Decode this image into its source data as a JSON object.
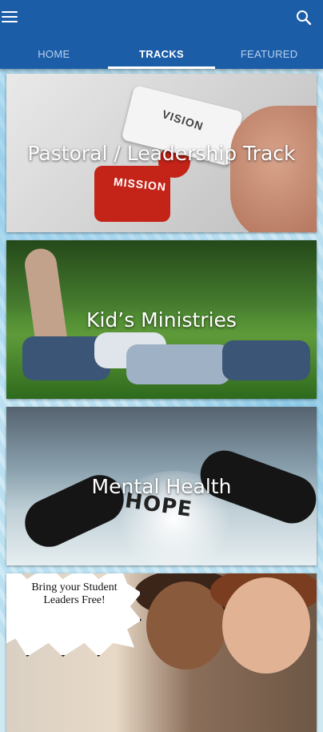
{
  "tabs": [
    {
      "label": "HOME",
      "active": false
    },
    {
      "label": "TRACKS",
      "active": true
    },
    {
      "label": "FEATURED",
      "active": false
    }
  ],
  "cards": [
    {
      "title": "Pastoral / Leadership Track",
      "image_words": [
        "VISION",
        "MISSION"
      ]
    },
    {
      "title": "Kid’s Ministries"
    },
    {
      "title": "Mental Health",
      "image_word": "HOPE"
    },
    {
      "title": "",
      "image_text": "Bring your Student Leaders Free!"
    }
  ],
  "icons": {
    "menu": "hamburger-menu-icon",
    "search": "search-icon"
  },
  "colors": {
    "appbar": "#1c5da8",
    "tab_active": "#ffffff",
    "tab_inactive": "#b9d2ee"
  }
}
